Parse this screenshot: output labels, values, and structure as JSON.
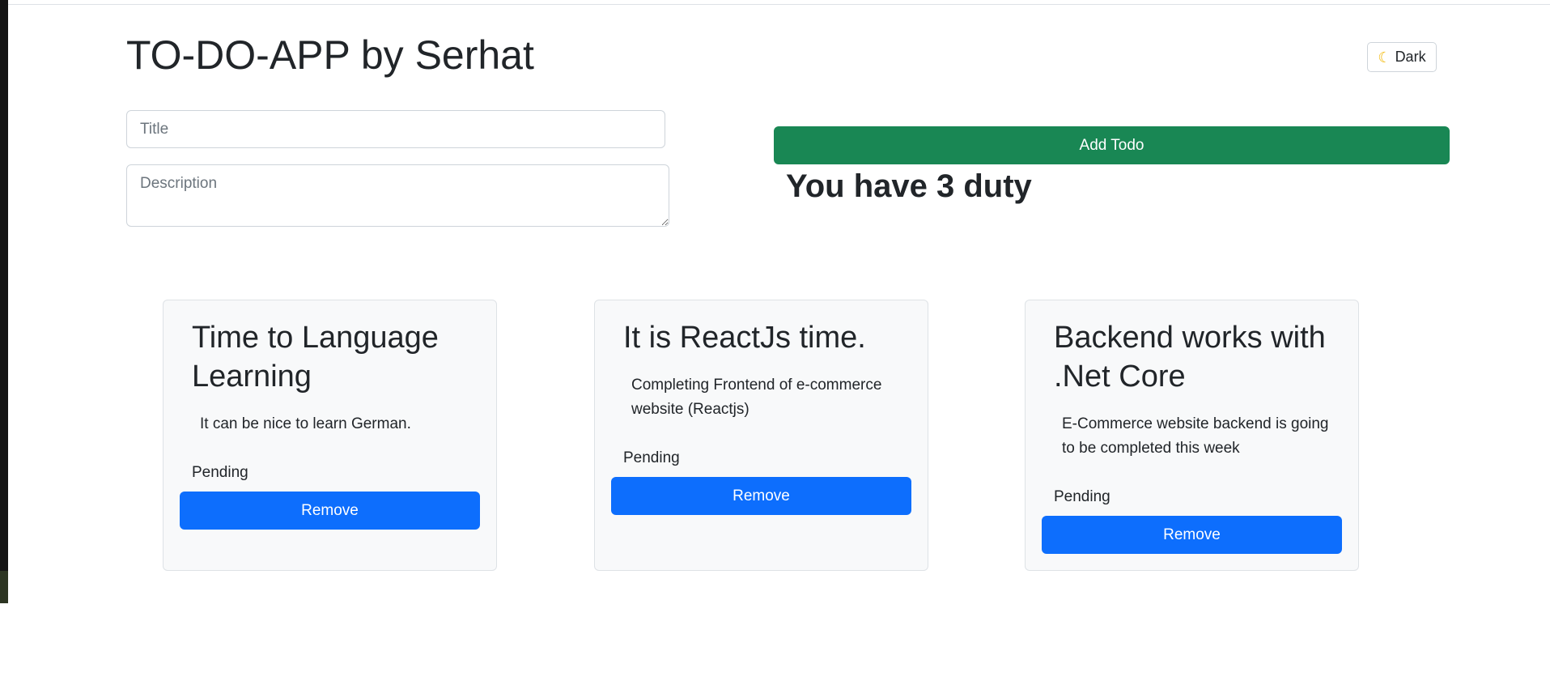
{
  "header": {
    "title": "TO-DO-APP by Serhat",
    "theme_toggle": {
      "icon": "moon-icon",
      "label": "Dark"
    }
  },
  "form": {
    "title_placeholder": "Title",
    "title_value": "",
    "description_placeholder": "Description",
    "description_value": "",
    "add_label": "Add Todo"
  },
  "summary": {
    "duty_text": "You have 3 duty"
  },
  "todos": [
    {
      "title": "Time to Language Learning",
      "description": "It can be nice to learn German.",
      "status": "Pending",
      "remove_label": "Remove"
    },
    {
      "title": "It is ReactJs time.",
      "description": "Completing Frontend of e-commerce website (Reactjs)",
      "status": "Pending",
      "remove_label": "Remove"
    },
    {
      "title": "Backend works with .Net Core",
      "description": "E-Commerce website backend is going to be completed this week",
      "status": "Pending",
      "remove_label": "Remove"
    }
  ],
  "colors": {
    "add_button": "#198754",
    "remove_button": "#0d6efd",
    "card_background": "#f8f9fa",
    "text": "#212529"
  }
}
